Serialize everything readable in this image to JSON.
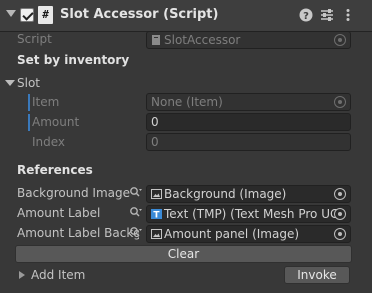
{
  "component": {
    "title": "Slot Accessor (Script)",
    "script_icon_glyph": "#",
    "icons": [
      "help-icon",
      "presets-icon",
      "more-menu-icon"
    ]
  },
  "script_row": {
    "label": "Script",
    "value": "SlotAccessor"
  },
  "set_by_inventory": {
    "header": "Set by inventory"
  },
  "slot": {
    "label": "Slot",
    "item": {
      "label": "Item",
      "value": "None (Item)"
    },
    "amount": {
      "label": "Amount",
      "value": "0"
    },
    "index": {
      "label": "Index",
      "value": "0"
    }
  },
  "references": {
    "header": "References",
    "background_image": {
      "label": "Background Image",
      "value": "Background (Image)"
    },
    "amount_label": {
      "label": "Amount Label",
      "value": "Text (TMP) (Text Mesh Pro UG"
    },
    "amount_label_background": {
      "label": "Amount Label Backgro",
      "value": "Amount panel (Image)"
    }
  },
  "clear_button": {
    "label": "Clear"
  },
  "add_item": {
    "label": "Add Item",
    "invoke_label": "Invoke"
  },
  "colors": {
    "accent": "#3a79bb",
    "background": "#383838"
  }
}
